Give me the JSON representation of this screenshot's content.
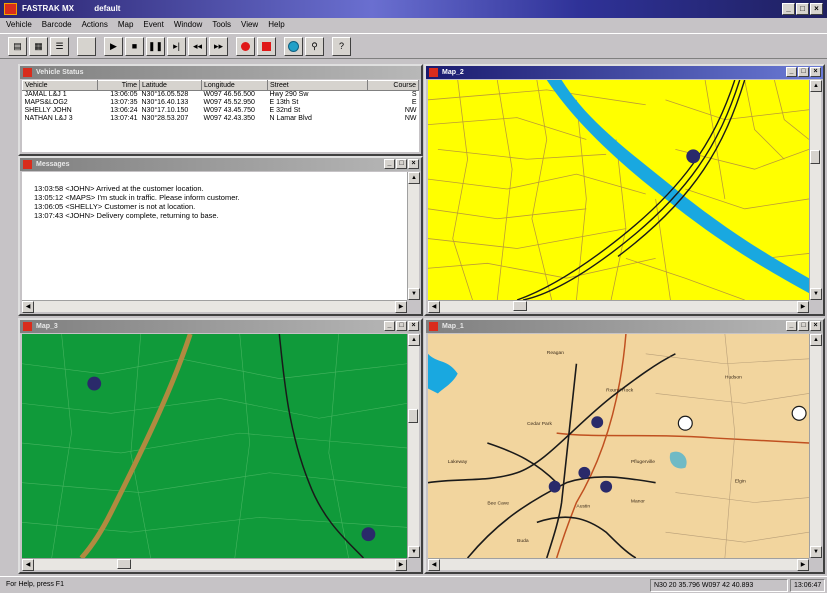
{
  "app": {
    "title": "FASTRAK MX",
    "document": "default"
  },
  "menu": [
    "Vehicle",
    "Barcode",
    "Actions",
    "Map",
    "Event",
    "Window",
    "Tools",
    "View",
    "Help"
  ],
  "windows": {
    "vehicle_status": {
      "title": "Vehicle Status",
      "columns": [
        "Vehicle",
        "Time",
        "Latitude",
        "Longitude",
        "Street",
        "Course"
      ],
      "rows": [
        [
          "JAMAL L&J 1",
          "13:06:05",
          "N30°16.05.528",
          "W097 46.56.500",
          "Hwy 290 Sw",
          "S"
        ],
        [
          "MAPS&LOG2",
          "13:07:35",
          "N30°16.40.133",
          "W097 45.52.950",
          "E 13th St",
          "E"
        ],
        [
          "SHELLY JOHN",
          "13:06:24",
          "N30°17.10.150",
          "W097 43.45.750",
          "E 32nd St",
          "NW"
        ],
        [
          "NATHAN L&J 3",
          "13:07:41",
          "N30°28.53.207",
          "W097 42.43.350",
          "N Lamar Blvd",
          "NW"
        ]
      ]
    },
    "messages": {
      "title": "Messages",
      "lines": [
        "13:03:58  <JOHN>  Arrived at the customer location.",
        "13:05:12  <MAPS>  I'm stuck in traffic.  Please inform customer.",
        "13:06:05  <SHELLY>  Customer is not at location.",
        "13:07:43  <JOHN>  Delivery complete, returning to base."
      ]
    },
    "map2": {
      "title": "Map_2"
    },
    "map3": {
      "title": "Map_3"
    },
    "map4": {
      "title": "Map_1"
    }
  },
  "map_labels": {
    "map4": [
      "Reagan",
      "Round Rock",
      "Pflugerville",
      "Cedar Park",
      "Austin",
      "Manor",
      "Lakeway",
      "Bee Cave",
      "Buda",
      "Hudson",
      "Elgin"
    ]
  },
  "status": {
    "help": "For Help, press F1",
    "coords": "N30 20 35.796  W097 42 40.893",
    "clock": "13:06:47"
  },
  "colors": {
    "title_active": "#1a1a6e",
    "map2_land": "#ffff00",
    "map2_water": "#19a8e0",
    "map3_land": "#109a3a",
    "map4_land": "#f2d59e",
    "vehicle_marker": "#2a2a6a"
  }
}
